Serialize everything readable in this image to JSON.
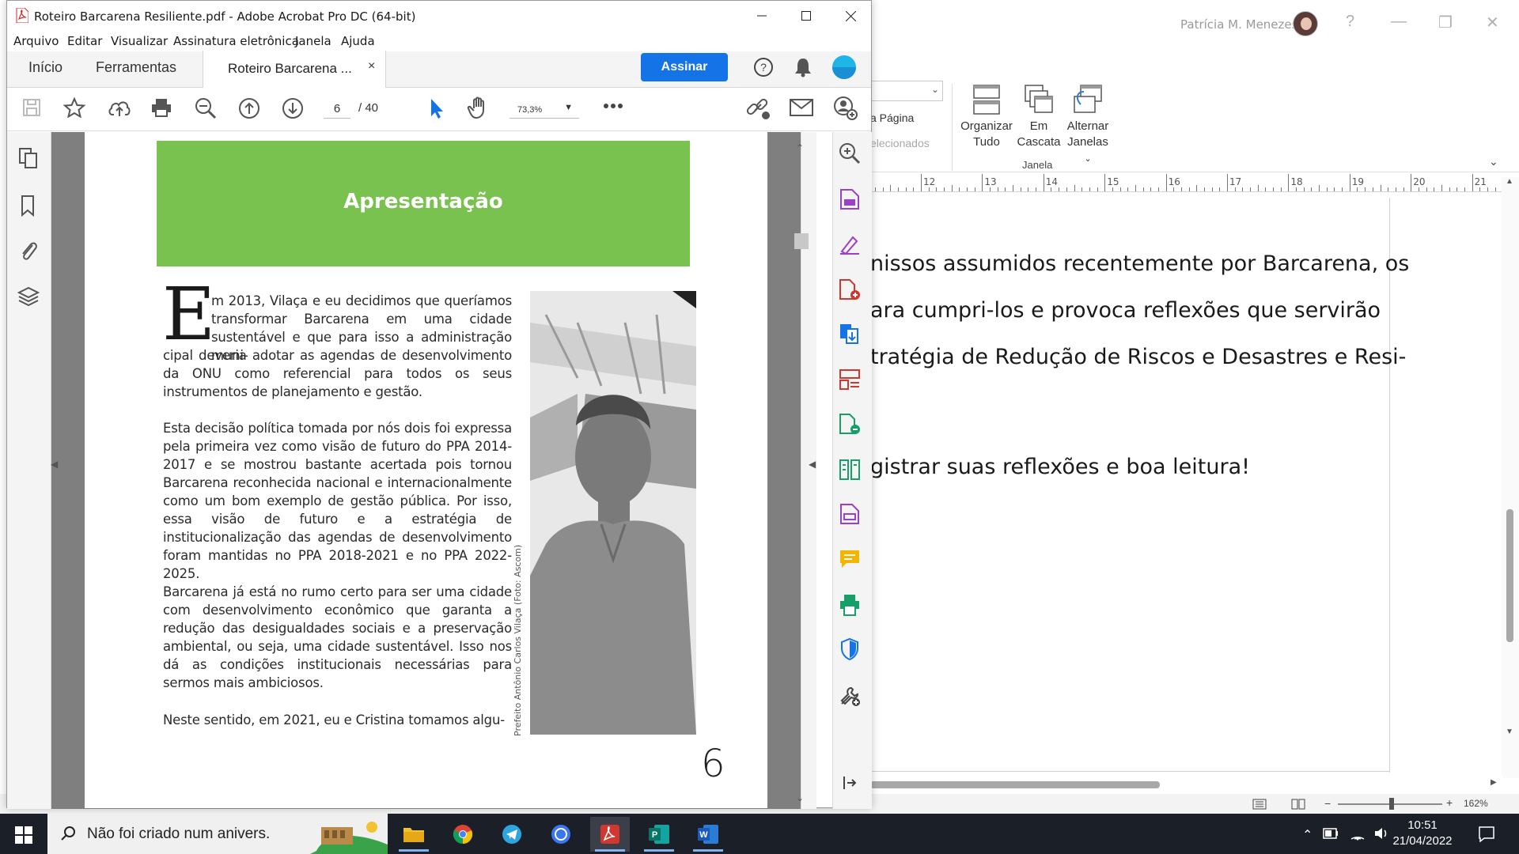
{
  "word": {
    "user_name": "Patrícia M. Menezes",
    "ribbon": {
      "view_page_label": "a Página",
      "selected_label": "elecionados",
      "arrange_all_line1": "Organizar",
      "arrange_all_line2": "Tudo",
      "cascade_line1": "Em",
      "cascade_line2": "Cascata",
      "switch_line1": "Alternar",
      "switch_line2": "Janelas",
      "group_label": "Janela"
    },
    "ruler_numbers": [
      "12",
      "13",
      "14",
      "15",
      "16",
      "17",
      "18",
      "19",
      "20",
      "21"
    ],
    "doc_lines": [
      "nissos assumidos recentemente por Barcarena, os",
      "ara cumpri-los e provoca reflexões que servirão",
      "tratégia de Redução de Riscos e Desastres e Resi-",
      "gistrar suas reflexões e boa leitura!"
    ],
    "zoom": "162%"
  },
  "acrobat": {
    "title": "Roteiro Barcarena Resiliente.pdf - Adobe Acrobat Pro DC (64-bit)",
    "menu": [
      "Arquivo",
      "Editar",
      "Visualizar",
      "Assinatura eletrônica",
      "Janela",
      "Ajuda"
    ],
    "tabs": {
      "home": "Início",
      "tools": "Ferramentas",
      "doc": "Roteiro Barcarena ...",
      "close": "×"
    },
    "sign_button": "Assinar",
    "page_current": "6",
    "page_total": "/ 40",
    "zoom": "73,3%",
    "accent_color": "#1473e6"
  },
  "pdf_page": {
    "banner_title": "Apresentação",
    "banner_color": "#79c250",
    "dropcap": "E",
    "para1_first": "m 2013, Vilaça e eu decidimos que queríamos transformar Barcarena em uma cidade sustentável e que para isso a administração muni-",
    "para1_rest": "cipal deveria adotar as agendas de desenvolvimento da ONU como referencial para todos os seus instrumentos de planejamento e gestão.",
    "para2": "Esta decisão política tomada por nós dois foi expressa pela primeira vez como visão de futuro do PPA 2014-2017 e se mostrou bastante acertada pois tornou Barcarena reconhecida nacional e internacionalmente como um bom exemplo de gestão pública. Por isso, essa visão de futuro e a estratégia de institucionalização das agendas de desenvolvimento foram mantidas no PPA 2018-2021 e no PPA 2022-2025.",
    "para3": "Barcarena já está no rumo certo para ser uma cidade com desenvolvimento econômico que garanta a redução das desigualdades sociais e a preservação ambiental, ou seja, uma cidade sustentável. Isso nos dá as condições institucionais necessárias para sermos mais ambiciosos.",
    "para4": "Neste sentido, em 2021, eu e Cristina tomamos algu-",
    "photo_caption": "Prefeito Antônio Carlos Vilaça (Foto: Ascom)",
    "page_number": "6"
  },
  "taskbar": {
    "search_text": "Não foi criado num anivers.",
    "time": "10:51",
    "date": "21/04/2022"
  }
}
